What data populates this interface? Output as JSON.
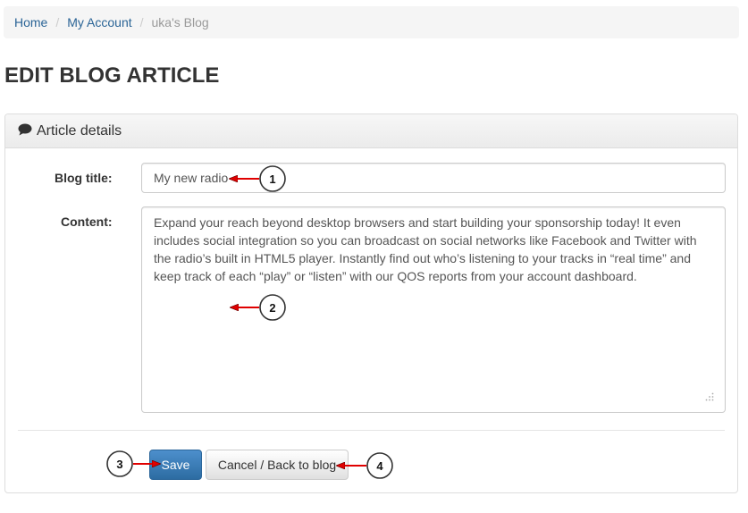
{
  "breadcrumb": {
    "items": [
      "Home",
      "My Account"
    ],
    "current": "uka's Blog"
  },
  "page_title": "EDIT BLOG ARTICLE",
  "panel": {
    "heading": "Article details",
    "heading_icon": "comment-icon"
  },
  "form": {
    "title_label": "Blog title:",
    "title_value": "My new radio",
    "content_label": "Content:",
    "content_value": "Expand your reach beyond desktop browsers and start building your sponsorship today! It even includes social integration so you can broadcast on social networks like Facebook and Twitter with the radio’s built in HTML5 player. Instantly find out who’s listening to your tracks in “real time” and keep track of each “play” or “listen” with our QOS reports from your account dashboard."
  },
  "buttons": {
    "save": "Save",
    "cancel": "Cancel / Back to blog"
  },
  "annotations": [
    "1",
    "2",
    "3",
    "4"
  ],
  "colors": {
    "link": "#2a6496",
    "primary_button": "#3071a9",
    "annotation_arrow": "#e00000"
  }
}
